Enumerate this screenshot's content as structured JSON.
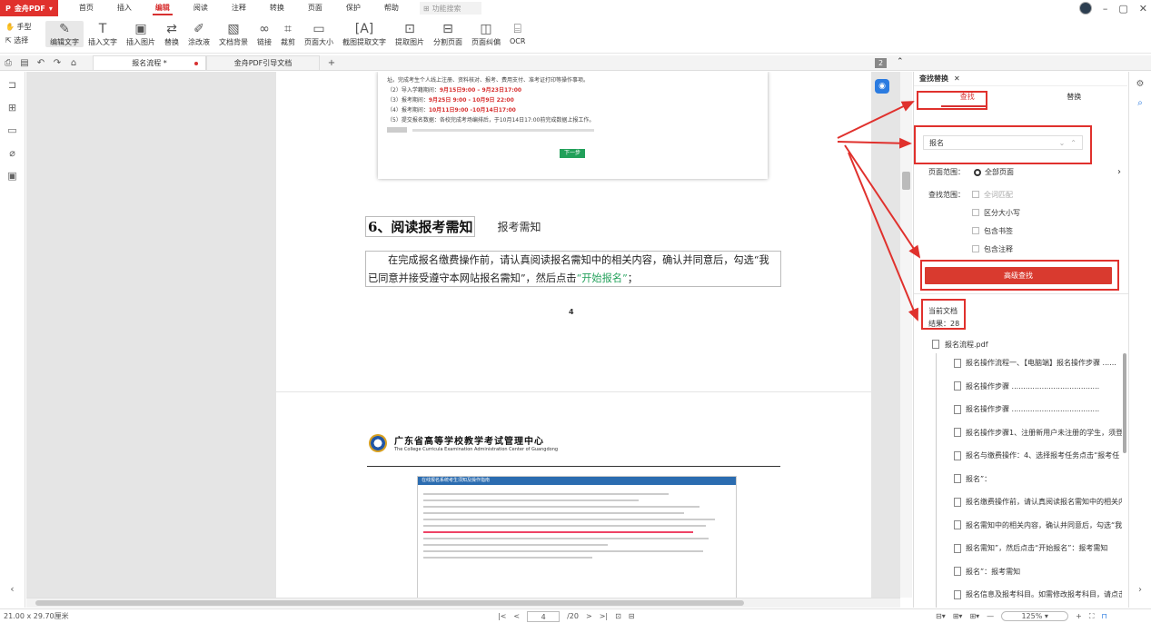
{
  "app": {
    "name": "金舟PDF",
    "menu": [
      "首页",
      "插入",
      "编辑",
      "阅读",
      "注释",
      "转换",
      "页面",
      "保护",
      "帮助"
    ],
    "active_menu": "编辑",
    "search_placeholder": "功能搜索"
  },
  "toolbar": {
    "left": [
      "手型",
      "选择"
    ],
    "tools": [
      "编辑文字",
      "插入文字",
      "插入图片",
      "替换",
      "涂改液",
      "文档背景",
      "链接",
      "裁剪",
      "页面大小",
      "截图提取文字",
      "提取图片",
      "分割页面",
      "页面纠偏",
      "OCR"
    ]
  },
  "tabs": [
    {
      "label": "报名流程 *"
    },
    {
      "label": "金舟PDF引导文档"
    }
  ],
  "page_badge": "2",
  "doc": {
    "top_lines": [
      "址。完成考生个人线上注册、资料核对、报考、费用支付、准考证打印等操作事项。",
      "（2）导入学籍期间：",
      "（3）报考期间：",
      "（4）报考期间：",
      "（5）提交报名数据：各校完成考场编排后，于10月14日17:00前完成数据上报工作。"
    ],
    "dates": [
      "9月15日9:00 – 9月23日17:00",
      "9月25日 9:00 - 10月9日 22:00",
      "10月11日9:00 -10月14日17:00"
    ],
    "next_btn": "下一步",
    "heading": "6、阅读报考需知",
    "heading_tag": "报考需知",
    "para": "在完成报名缴费操作前，请认真阅读报名需知中的相关内容，确认并同意后，勾选“我已同意并接受遵守本网站报名需知”，然后点击",
    "para_link": "“开始报名”",
    "para_end": "；",
    "page_num": "4",
    "page2_title": "广东省高等学校教学考试管理中心",
    "page2_sub": "The College Curricula Examination Administration Center of Guangdong",
    "page2_box_title": "在线报名系统考生须知及操作指南"
  },
  "panel": {
    "tab": "查找替换",
    "find_tab": "查找",
    "replace_tab": "替换",
    "search_value": "报名",
    "page_range_label": "页面范围：",
    "page_range_value": "全部页面",
    "scope_label": "查找范围：",
    "options": [
      "全词匹配",
      "区分大小写",
      "包含书签",
      "包含注释"
    ],
    "adv_button": "高级查找",
    "current_doc": "当前文档",
    "result_label": "结果：28",
    "file": "报名流程.pdf",
    "results": [
      "报名操作流程一、【电脑端】报名操作步骤 ......",
      "报名操作步骤 ......................................",
      "报名操作步骤 ......................................",
      "报名操作步骤1、注册新用户未注册的学生，须登",
      "报名与缴费操作：4、选择报考任务点击“报考任",
      "报名”：",
      "报名缴费操作前，请认真阅读报名需知中的相关内",
      "报名需知中的相关内容，确认并同意后，勾选“我",
      "报名需知”，然后点击“开始报名”：报考需知",
      "报名”：报考需知",
      "报名信息及报考科目。如需修改报考科目，请点击"
    ]
  },
  "status": {
    "size": "21.00 x 29.70厘米",
    "page": "4",
    "total": "/20",
    "zoom": "125%"
  },
  "colors": {
    "brand": "#e0312d",
    "accent": "#d73030",
    "link": "#22a05a"
  }
}
